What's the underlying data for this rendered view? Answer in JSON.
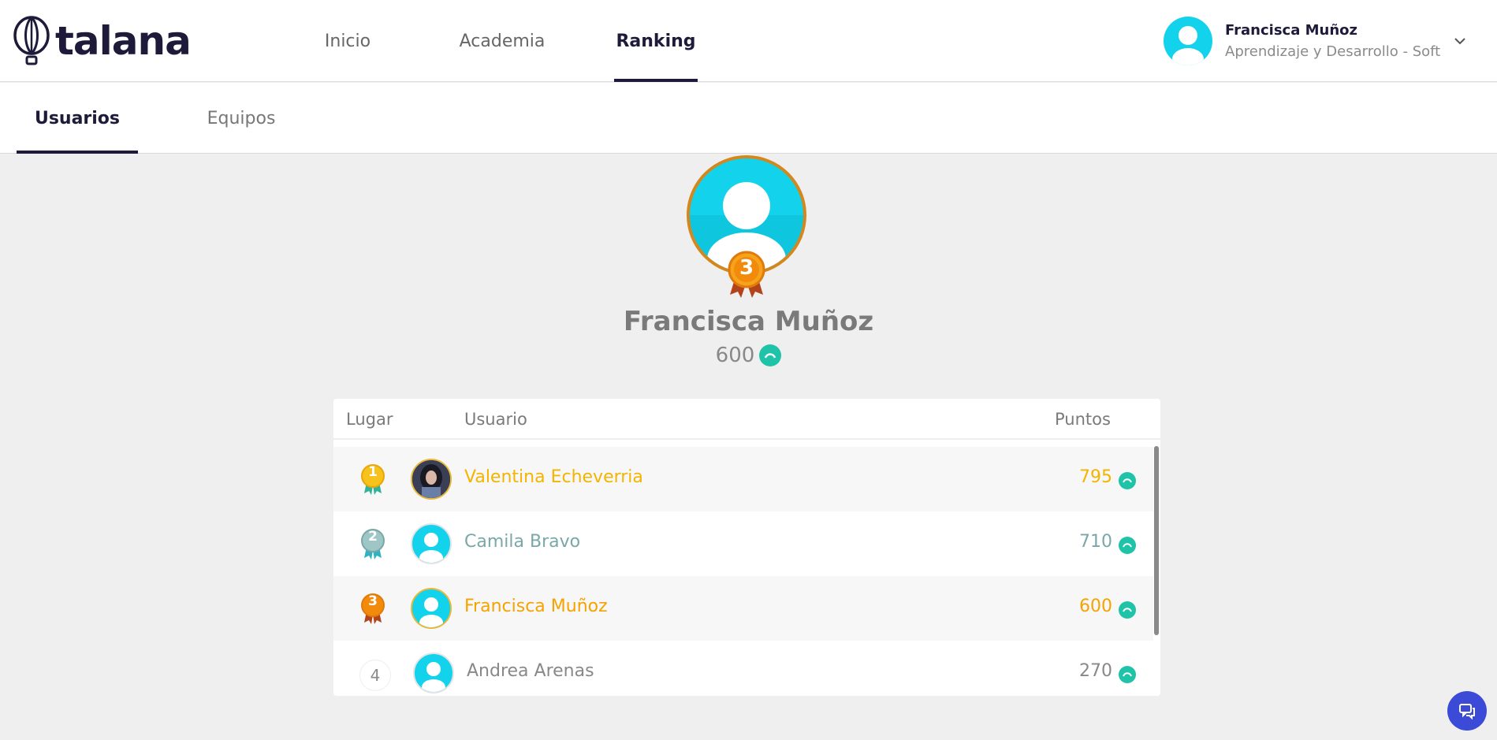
{
  "app": {
    "logo_text": "talana"
  },
  "nav": {
    "items": [
      {
        "label": "Inicio",
        "active": false
      },
      {
        "label": "Academia",
        "active": false
      },
      {
        "label": "Ranking",
        "active": true
      }
    ]
  },
  "user": {
    "name": "Francisca Muñoz",
    "role": "Aprendizaje y Desarrollo - Soft"
  },
  "subtabs": [
    {
      "label": "Usuarios",
      "active": true
    },
    {
      "label": "Equipos",
      "active": false
    }
  ],
  "hero": {
    "name": "Francisca Muñoz",
    "points": "600",
    "rank_badge": "3"
  },
  "table": {
    "headers": {
      "place": "Lugar",
      "user": "Usuario",
      "points": "Puntos"
    },
    "rows": [
      {
        "place": "1",
        "name": "Valentina Echeverria",
        "points": "795",
        "color": "#f5b400"
      },
      {
        "place": "2",
        "name": "Camila Bravo",
        "points": "710",
        "color": "#7aa7a7"
      },
      {
        "place": "3",
        "name": "Francisca Muñoz",
        "points": "600",
        "color": "#f5a300"
      },
      {
        "place": "4",
        "name": "Andrea Arenas",
        "points": "270",
        "color": "#888888"
      }
    ]
  },
  "colors": {
    "brand_dark": "#1e1b3a",
    "avatar_cyan": "#12d3eb",
    "coin_teal": "#1fc4a8",
    "gold": "#f5b400",
    "bronze": "#e8840e",
    "silver": "#8fb7b7",
    "chat_blue": "#3b4bd8"
  }
}
